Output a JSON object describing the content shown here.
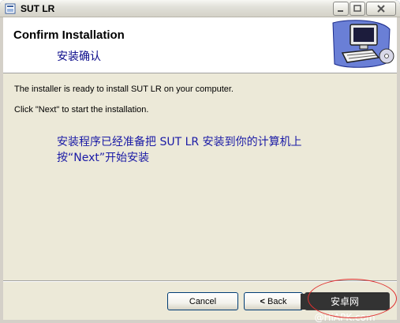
{
  "window": {
    "title": "SUT LR"
  },
  "header": {
    "title": "Confirm Installation",
    "subtitle": "安装确认",
    "art_icon": "computer-cd-icon"
  },
  "body": {
    "line1": "The installer is ready to install SUT LR on your computer.",
    "line2": "Click \"Next\" to start the installation.",
    "cn_line1": "安装程序已经准备把 SUT LR 安装到你的计算机上",
    "cn_line2": "按“Next”开始安装"
  },
  "buttons": {
    "cancel": "Cancel",
    "back_arrow": "<",
    "back": "Back"
  },
  "watermark": "安卓网@HiAPK.com",
  "colors": {
    "accent_text": "#1a1aa6",
    "highlight_ring": "#e03030"
  }
}
